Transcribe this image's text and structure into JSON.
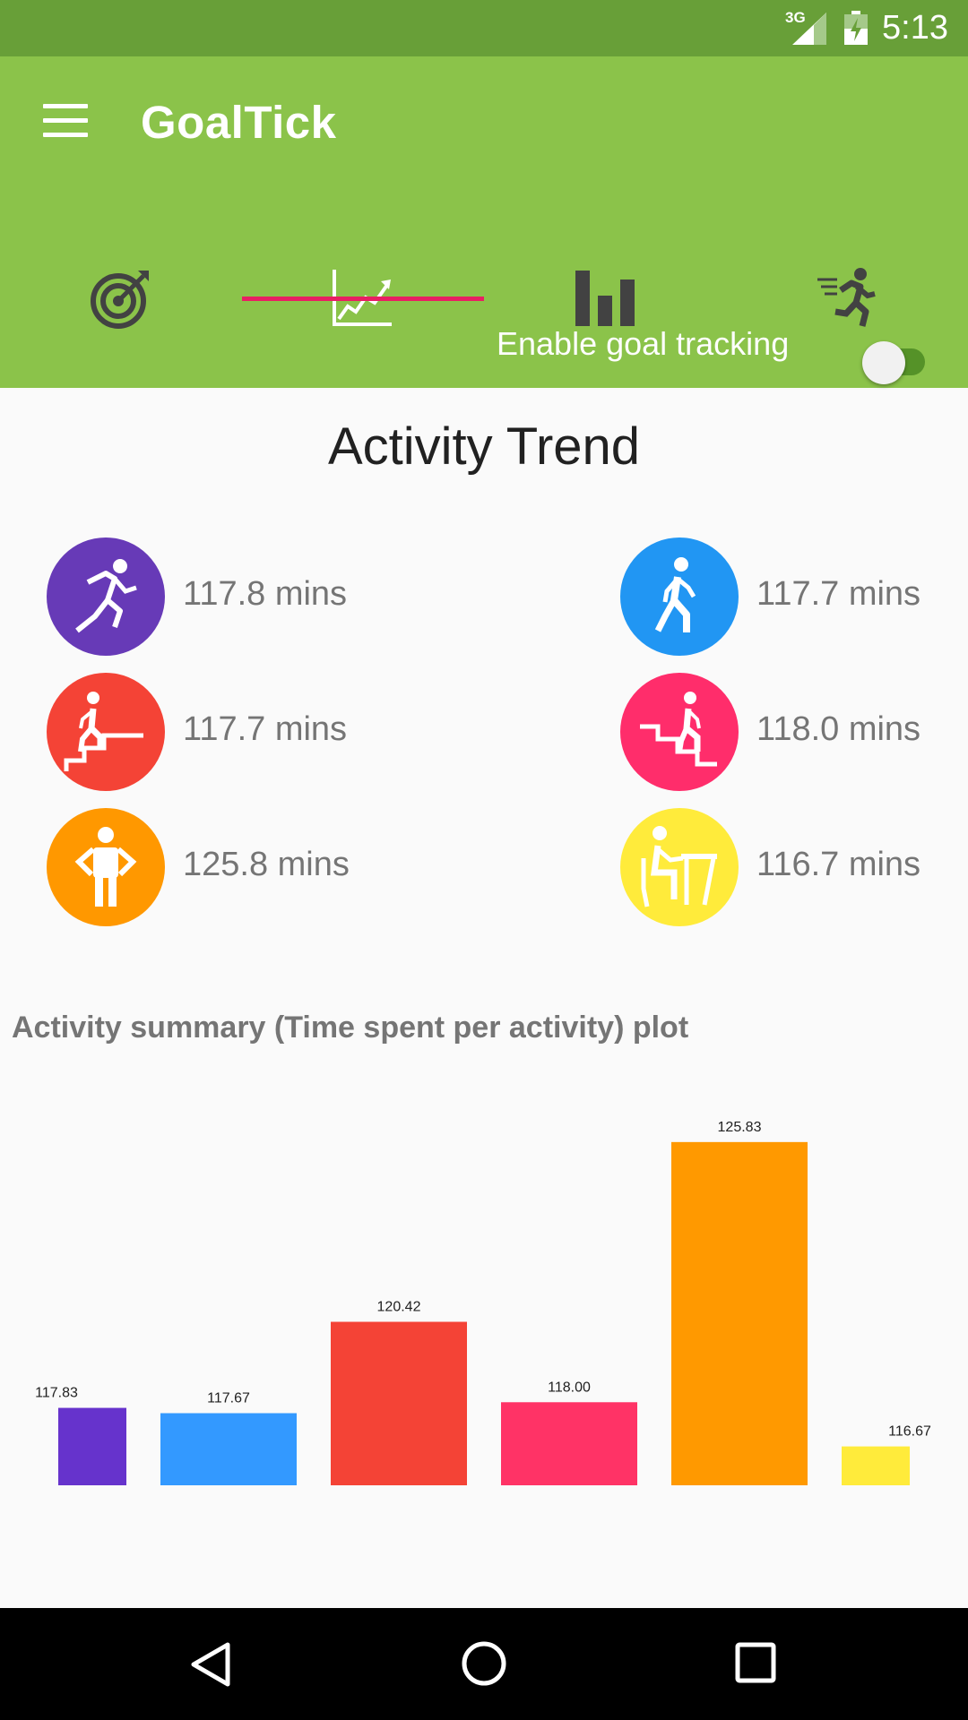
{
  "status_bar": {
    "network": "3G",
    "time": "5:13"
  },
  "app_bar": {
    "title": "GoalTick",
    "menu_icon": "hamburger-menu-icon"
  },
  "tabs": [
    {
      "name": "goals",
      "icon": "target-icon",
      "selected": false
    },
    {
      "name": "trend",
      "icon": "trend-line-icon",
      "selected": true
    },
    {
      "name": "stats",
      "icon": "bar-chart-icon",
      "selected": false
    },
    {
      "name": "activity",
      "icon": "running-person-icon",
      "selected": false
    }
  ],
  "goal_tracking": {
    "label": "Enable goal tracking",
    "enabled": false
  },
  "section_title": "Activity Trend",
  "activities": [
    {
      "icon": "running-icon",
      "color": "#673ab7",
      "value": "117.8 mins"
    },
    {
      "icon": "walking-icon",
      "color": "#2196f3",
      "value": "117.7 mins"
    },
    {
      "icon": "stairs-up-icon",
      "color": "#f44336",
      "value": "117.7 mins"
    },
    {
      "icon": "stairs-down-icon",
      "color": "#ff2d6b",
      "value": "118.0 mins"
    },
    {
      "icon": "standing-icon",
      "color": "#ff9800",
      "value": "125.8 mins"
    },
    {
      "icon": "sitting-icon",
      "color": "#ffeb3b",
      "value": "116.7 mins"
    }
  ],
  "plot_title": "Activity summary (Time spent per activity) plot",
  "chart_data": {
    "type": "bar",
    "values": [
      117.83,
      117.67,
      120.42,
      118.0,
      125.83,
      116.67
    ],
    "labels": [
      "117.83",
      "117.67",
      "120.42",
      "118.00",
      "125.83",
      "116.67"
    ],
    "colors": [
      "#6633cc",
      "#3399ff",
      "#f44336",
      "#ff3366",
      "#ff9900",
      "#ffeb3b"
    ],
    "ylim": [
      115.5,
      126.5
    ],
    "grid": false,
    "axes_visible": false
  },
  "nav_bar": {
    "back": "back-triangle-icon",
    "home": "home-circle-icon",
    "recents": "recents-square-icon"
  }
}
